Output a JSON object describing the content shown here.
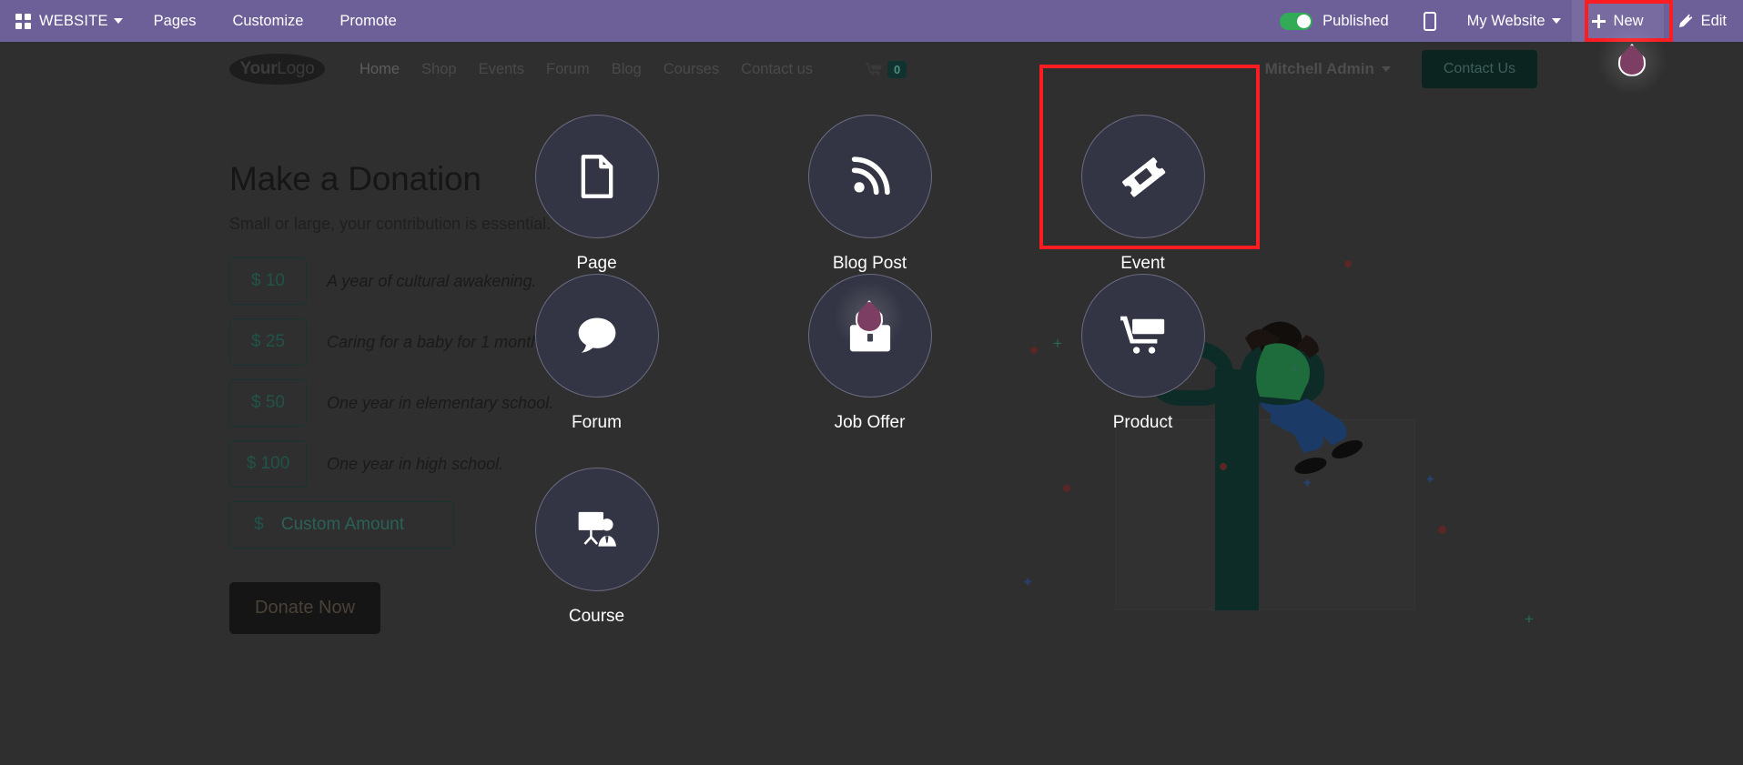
{
  "systray": {
    "apps_icon": "apps-grid-icon",
    "brand": "WEBSITE",
    "menus": [
      "Pages",
      "Customize",
      "Promote"
    ],
    "published_label": "Published",
    "published_state": "on",
    "mobile_icon": "mobile-preview-icon",
    "website_selector": "My Website",
    "new_label": "New",
    "edit_label": "Edit",
    "accent_purple": "#6d6099",
    "toggle_green": "#31ab55",
    "highlight_red": "#fb1d22"
  },
  "site_header": {
    "logo_bold": "Your",
    "logo_light": "Logo",
    "nav": [
      "Home",
      "Shop",
      "Events",
      "Forum",
      "Blog",
      "Courses",
      "Contact us"
    ],
    "active_nav": "Home",
    "cart_icon": "shopping-cart-icon",
    "cart_count": "0",
    "user_name": "Mitchell Admin",
    "contact_button": "Contact Us"
  },
  "donation": {
    "title": "Make a Donation",
    "subtitle": "Small or large, your contribution is essential.",
    "options": [
      {
        "amount": "$ 10",
        "description": "A year of cultural awakening."
      },
      {
        "amount": "$ 25",
        "description": "Caring for a baby for 1 month."
      },
      {
        "amount": "$ 50",
        "description": "One year in elementary school."
      },
      {
        "amount": "$ 100",
        "description": "One year in high school."
      }
    ],
    "custom": {
      "currency": "$",
      "placeholder": "Custom Amount",
      "value": ""
    },
    "donate_button": "Donate Now"
  },
  "new_content_overlay": {
    "tiles": [
      {
        "label": "Page",
        "icon": "document-icon",
        "highlighted": false
      },
      {
        "label": "Blog Post",
        "icon": "rss-feed-icon",
        "highlighted": false
      },
      {
        "label": "Event",
        "icon": "ticket-icon",
        "highlighted": true
      },
      {
        "label": "Forum",
        "icon": "chat-bubble-icon",
        "highlighted": false
      },
      {
        "label": "Job Offer",
        "icon": "briefcase-icon",
        "highlighted": false
      },
      {
        "label": "Product",
        "icon": "shopping-cart-icon",
        "highlighted": false
      },
      {
        "label": "Course",
        "icon": "whiteboard-teacher-icon",
        "highlighted": false
      }
    ],
    "circle_fill": "#343544",
    "circle_border": "#6a6a80"
  },
  "cursors": [
    {
      "name": "cursor-marker-new-button"
    },
    {
      "name": "cursor-marker-job-offer"
    }
  ]
}
